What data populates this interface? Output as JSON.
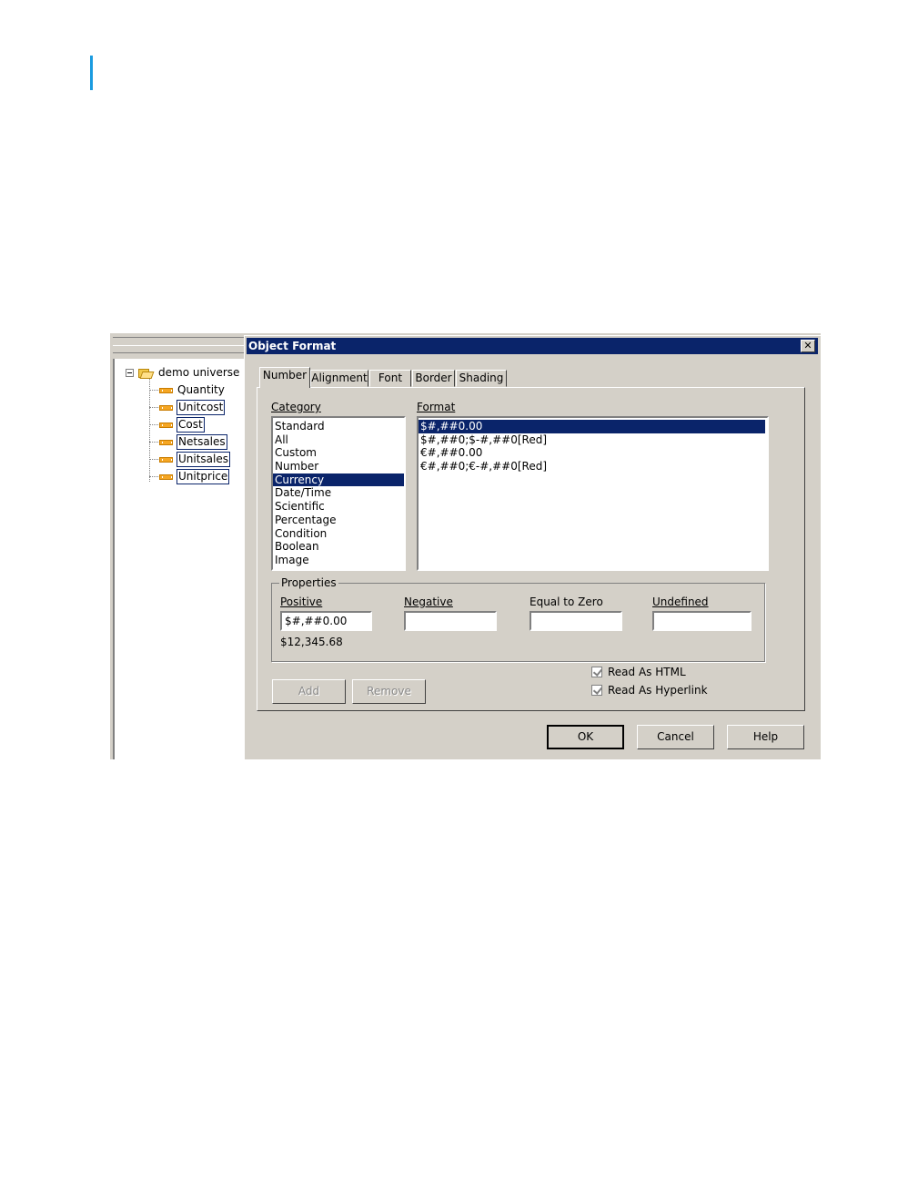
{
  "tree": {
    "root_label": "demo universe",
    "items": [
      {
        "label": "Quantity"
      },
      {
        "label": "Unitcost"
      },
      {
        "label": "Cost"
      },
      {
        "label": "Netsales"
      },
      {
        "label": "Unitsales"
      },
      {
        "label": "Unitprice"
      }
    ]
  },
  "dialog": {
    "title": "Object Format",
    "close_glyph": "✕",
    "tabs": [
      "Number",
      "Alignment",
      "Font",
      "Border",
      "Shading"
    ],
    "active_tab": "Number",
    "category_label": "Category",
    "category_items": [
      "Standard",
      "All",
      "Custom",
      "Number",
      "Currency",
      "Date/Time",
      "Scientific",
      "Percentage",
      "Condition",
      "Boolean",
      "Image"
    ],
    "category_selected": "Currency",
    "format_label": "Format",
    "format_items": [
      "$#,##0.00",
      "$#,##0;$-#,##0[Red]",
      "€#,##0.00",
      "€#,##0;€-#,##0[Red]"
    ],
    "format_selected": "$#,##0.00",
    "properties": {
      "title": "Properties",
      "positive_label": "Positive",
      "positive_value": "$#,##0.00",
      "positive_preview": "$12,345.68",
      "negative_label": "Negative",
      "negative_value": "",
      "zero_label": "Equal to Zero",
      "zero_value": "",
      "undefined_label": "Undefined",
      "undefined_value": ""
    },
    "add_label": "Add",
    "remove_label": "Remove",
    "read_as_html_label": "Read As HTML",
    "read_as_html_checked": true,
    "read_as_hyperlink_label": "Read As Hyperlink",
    "read_as_hyperlink_checked": true,
    "ok_label": "OK",
    "cancel_label": "Cancel",
    "help_label": "Help"
  },
  "colors": {
    "face": "#d4d0c8",
    "title_bar": "#0a246a",
    "selection": "#0a246a",
    "margin_bar": "#1a9be0"
  }
}
